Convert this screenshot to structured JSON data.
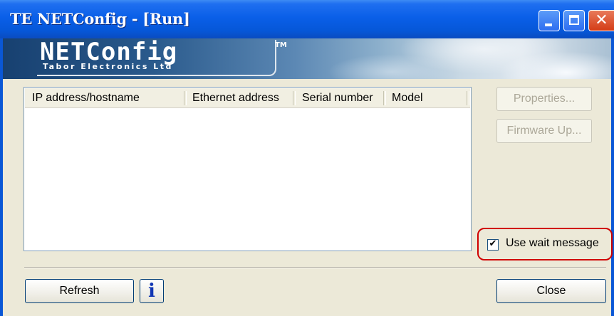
{
  "window": {
    "title": "TE NETConfig - [Run]",
    "close_glyph": "✕",
    "colors": {
      "titlebar": "#0a5fe8",
      "face": "#ece9d8",
      "highlight_ring": "#d00000",
      "info_icon": "#1236b4"
    }
  },
  "banner": {
    "logo_name": "NETConfig",
    "logo_tm": "TM",
    "logo_subtitle": "Tabor Electronics Ltd"
  },
  "device_list": {
    "columns": [
      "IP address/hostname",
      "Ethernet address",
      "Serial number",
      "Model"
    ],
    "rows": []
  },
  "buttons": {
    "properties": "Properties...",
    "firmware": "Firmware Up...",
    "refresh": "Refresh",
    "close": "Close",
    "info_glyph": "i"
  },
  "options": {
    "use_wait_message": {
      "label": "Use wait message",
      "checked": true,
      "check_glyph": "✔"
    }
  }
}
